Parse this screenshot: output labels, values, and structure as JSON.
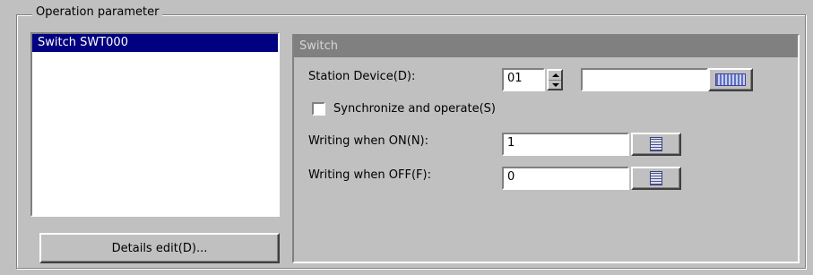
{
  "group": {
    "title": "Operation parameter"
  },
  "list": {
    "items": [
      "Switch SWT000"
    ]
  },
  "buttons": {
    "details_edit": "Details edit(D)..."
  },
  "panel": {
    "title": "Switch",
    "station_device_label": "Station Device(D):",
    "station_device_value": "01",
    "device_text_value": "",
    "sync_label": "Synchronize and operate(S)",
    "on_label": "Writing when ON(N):",
    "on_value": "1",
    "off_label": "Writing when OFF(F):",
    "off_value": "0"
  },
  "icons": {
    "keyboard": "keyboard-icon",
    "calculator": "calculator-icon"
  }
}
